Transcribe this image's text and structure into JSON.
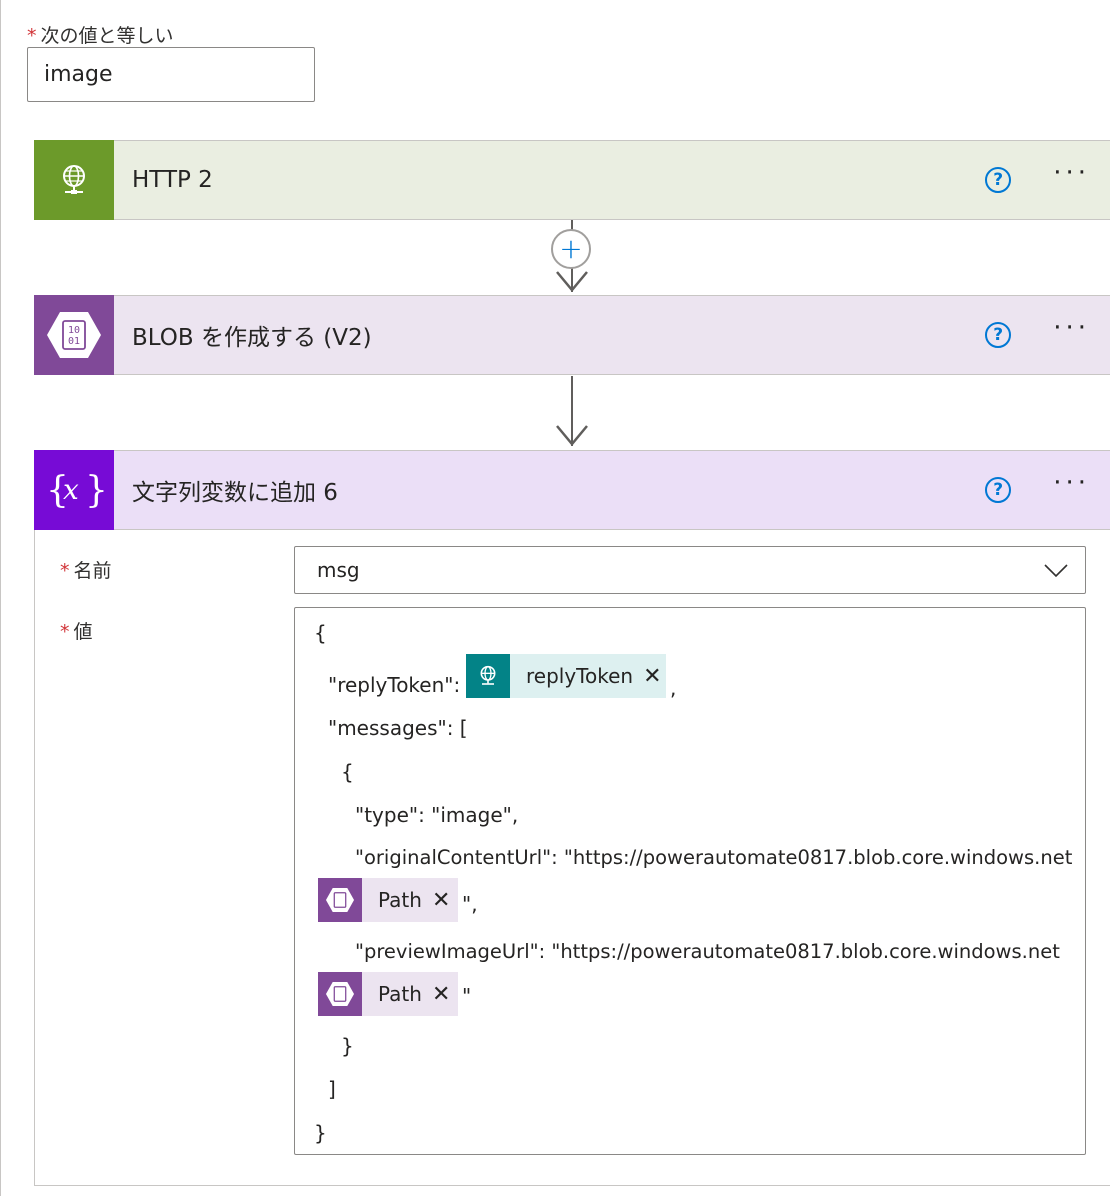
{
  "condition": {
    "required_mark": "*",
    "label": "次の値と等しい",
    "value": "image"
  },
  "actions": [
    {
      "title": "HTTP 2",
      "icon": "globe-icon",
      "color": "#6c9a2a",
      "header_bg": "#eaeee1"
    },
    {
      "title": "BLOB を作成する (V2)",
      "icon": "blob-icon",
      "color": "#804998",
      "header_bg": "#ece4f0"
    },
    {
      "title": "文字列変数に追加 6",
      "icon": "variable-icon",
      "color": "#770bd6",
      "header_bg": "#ebdff7"
    }
  ],
  "help_glyph": "?",
  "more_glyph": "···",
  "add_glyph": "+",
  "form": {
    "name_label": "名前",
    "name_value": "msg",
    "value_label": "値",
    "required_mark": "*"
  },
  "value_lines": {
    "l1": "{",
    "l2_prefix": "\"replyToken\":",
    "l2_suffix": ",",
    "l3": "\"messages\": [",
    "l4": "{",
    "l5": "\"type\": \"image\",",
    "l6": "\"originalContentUrl\": \"https://powerautomate0817.blob.core.windows.net",
    "l7_suffix": "\",",
    "l8": "\"previewImageUrl\": \"https://powerautomate0817.blob.core.windows.net",
    "l9_suffix": "\"",
    "l10": "}",
    "l11": "]",
    "l12": "}"
  },
  "tokens": {
    "reply_token": {
      "label": "replyToken",
      "icon": "globe-icon",
      "color": "#038387",
      "bg": "#ddf0f0"
    },
    "path_1": {
      "label": "Path",
      "icon": "blob-icon",
      "color": "#804998",
      "bg": "#ece4f0"
    },
    "path_2": {
      "label": "Path",
      "icon": "blob-icon",
      "color": "#804998",
      "bg": "#ece4f0"
    },
    "close_glyph": "✕"
  }
}
